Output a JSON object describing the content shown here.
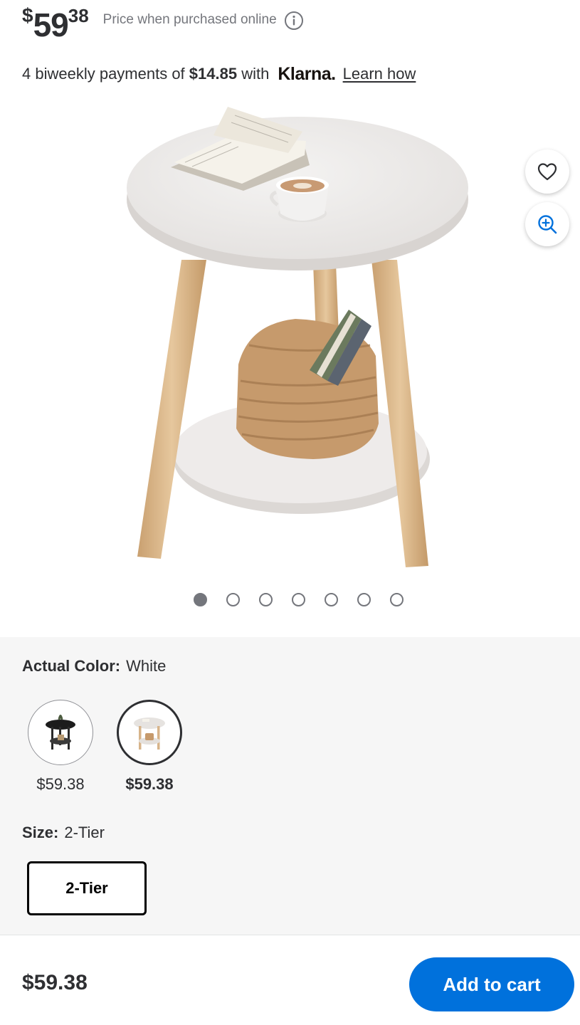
{
  "price": {
    "currency": "$",
    "dollars": "59",
    "cents": "38",
    "note": "Price when purchased online",
    "info_icon": "info-icon"
  },
  "klarna": {
    "prefix": "4 biweekly payments of",
    "amount": "$14.85",
    "with": "with",
    "brand": "Klarna.",
    "link": "Learn how"
  },
  "image": {
    "carousel_total": 7,
    "carousel_active": 0,
    "favorite_icon": "heart-icon",
    "zoom_icon": "zoom-in-icon"
  },
  "color": {
    "label": "Actual Color:",
    "value": "White",
    "options": [
      {
        "price": "$59.38",
        "selected": false,
        "color": "#1c1c1c"
      },
      {
        "price": "$59.38",
        "selected": true,
        "color": "#f2f0ee"
      }
    ]
  },
  "size": {
    "label": "Size:",
    "value": "2-Tier",
    "options": [
      "2-Tier"
    ]
  },
  "bottom_bar": {
    "price": "$59.38",
    "cta": "Add to cart"
  },
  "colors": {
    "accent": "#0071dc",
    "text": "#2e2f32",
    "muted": "#74767c",
    "section_bg": "#f6f6f6"
  }
}
